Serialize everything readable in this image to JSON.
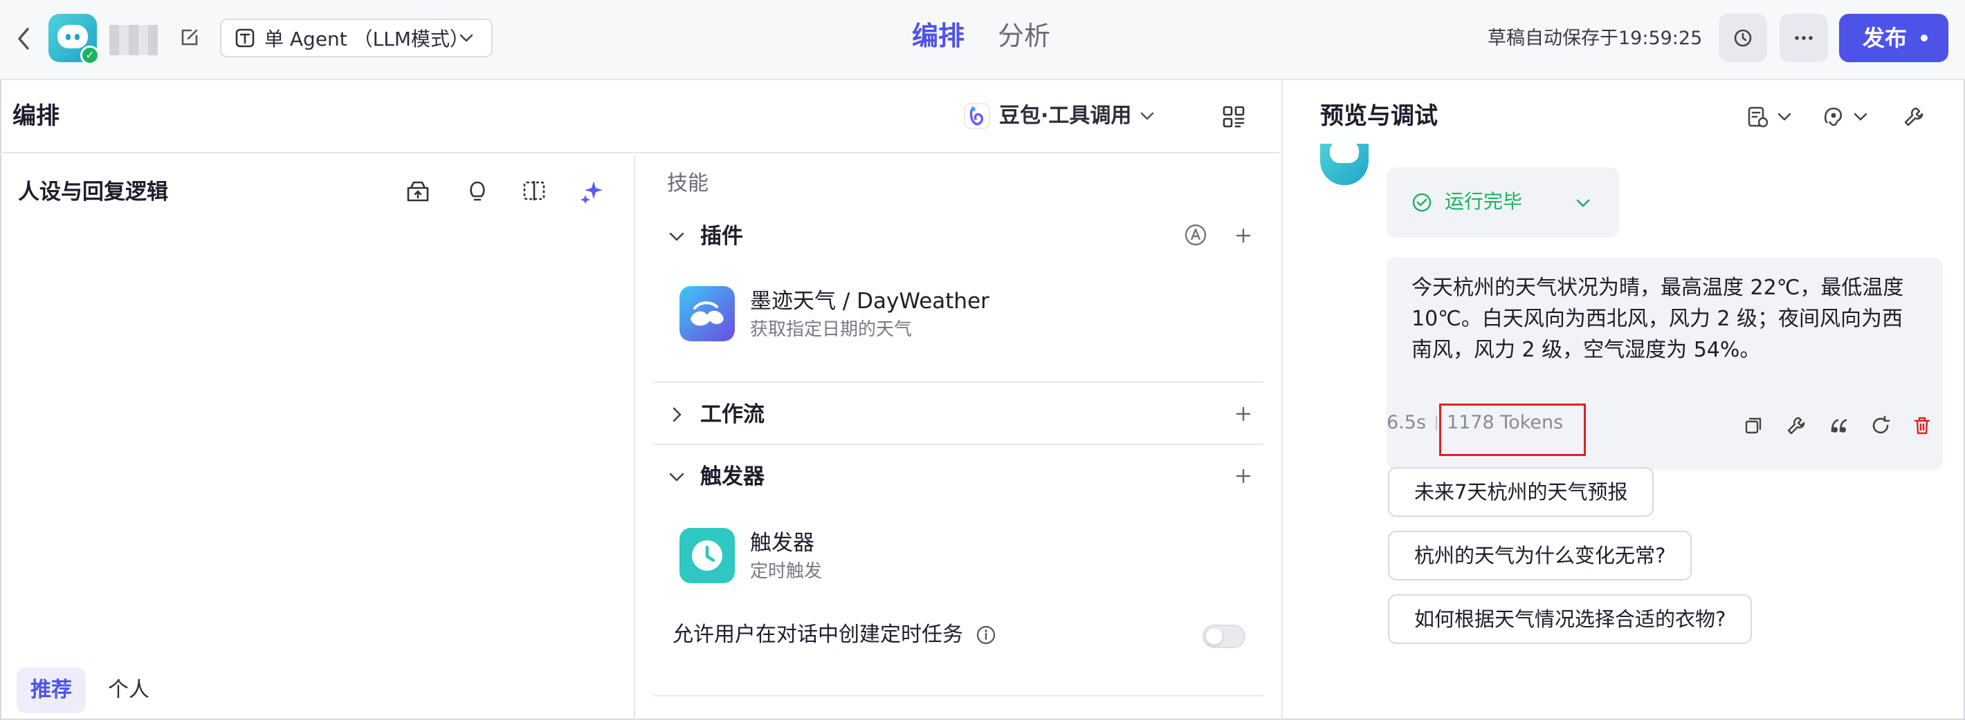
{
  "header": {
    "mode_label": "单 Agent （LLM模式）",
    "tabs": [
      {
        "label": "编排",
        "active": true
      },
      {
        "label": "分析",
        "active": false
      }
    ],
    "autosave_text": "草稿自动保存于19:59:25",
    "publish_label": "发布"
  },
  "editor": {
    "title": "编排",
    "model_label": "豆包·工具调用"
  },
  "persona": {
    "title": "人设与回复逻辑",
    "tabs": [
      {
        "label": "推荐",
        "active": true
      },
      {
        "label": "个人",
        "active": false
      }
    ]
  },
  "skills": {
    "label": "技能",
    "plugins": {
      "title": "插件",
      "items": [
        {
          "name": "墨迹天气 / DayWeather",
          "desc": "获取指定日期的天气",
          "icon": "moji-weather-icon"
        }
      ]
    },
    "workflow": {
      "title": "工作流"
    },
    "triggers": {
      "title": "触发器",
      "items": [
        {
          "name": "触发器",
          "desc": "定时触发",
          "icon": "clock-icon"
        }
      ]
    },
    "allow_task_label": "允许用户在对话中创建定时任务",
    "allow_task_enabled": false
  },
  "preview": {
    "title": "预览与调试",
    "run_status": "运行完毕",
    "reply_text": "今天杭州的天气状况为晴，最高温度 22℃，最低温度 10℃。白天风向为西北风，风力 2 级；夜间风向为西南风，风力 2 级，空气湿度为 54%。",
    "elapsed": "6.5s",
    "tokens": "1178 Tokens",
    "suggestions": [
      "未来7天杭州的天气预报",
      "杭州的天气为什么变化无常?",
      "如何根据天气情况选择合适的衣物?"
    ]
  },
  "colors": {
    "accent": "#4d53e8",
    "success": "#19b35f",
    "danger": "#e02020"
  }
}
